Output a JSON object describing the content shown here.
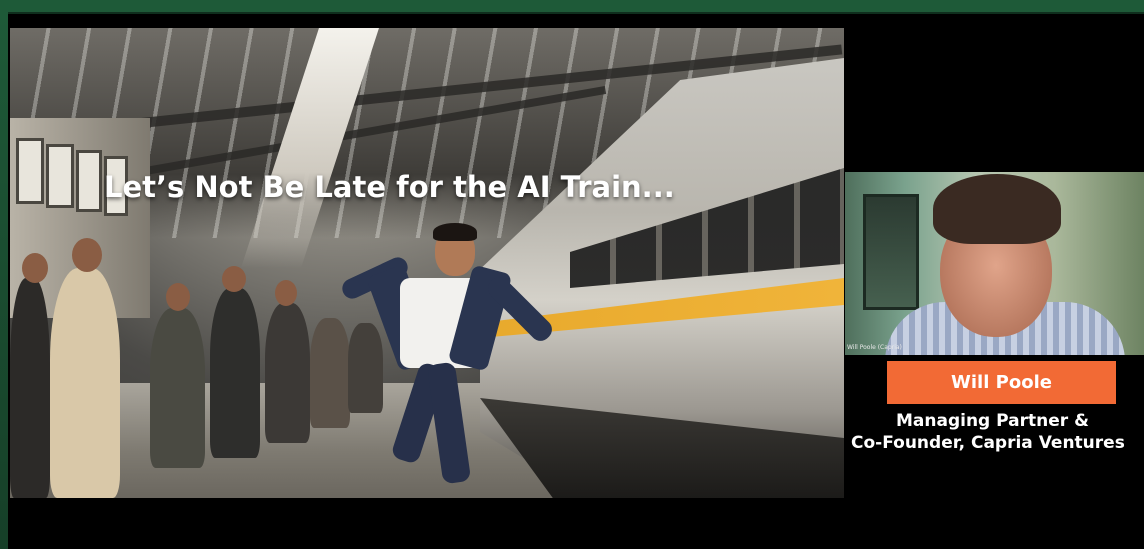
{
  "slide": {
    "title": "Let’s Not Be Late for the AI Train..."
  },
  "speaker": {
    "video_label": "Will Poole (Capria)",
    "name": "Will Poole",
    "title_line1": "Managing Partner &",
    "title_line2": "Co-Founder, Capria Ventures"
  },
  "colors": {
    "frame": "#1e5a38",
    "badge": "#f26a35",
    "background": "#000000"
  }
}
